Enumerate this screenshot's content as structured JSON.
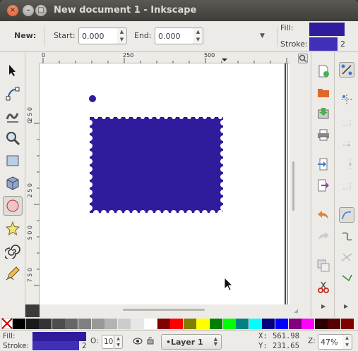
{
  "window": {
    "title": "New document 1 - Inkscape"
  },
  "controls": {
    "new_label": "New:",
    "start_label": "Start:",
    "start_value": "0.000",
    "end_label": "End:",
    "end_value": "0.000",
    "fill_label": "Fill:",
    "stroke_label": "Stroke:",
    "stroke_width": "2",
    "fill_color": "#2e1c9c"
  },
  "ruler": {
    "top_ticks": [
      "0",
      "250",
      "500"
    ],
    "left_ticks": [
      "2 5 0",
      "0",
      "2 5 0",
      "5 0 0",
      "7 5 0"
    ]
  },
  "tools": [
    "selector-tool",
    "node-tool",
    "tweak-tool",
    "zoom-tool",
    "rect-tool",
    "3dbox-tool",
    "ellipse-tool",
    "star-tool",
    "spiral-tool",
    "pencil-tool"
  ],
  "palette": [
    "#000000",
    "#1a1a1a",
    "#333333",
    "#4d4d4d",
    "#666666",
    "#808080",
    "#999999",
    "#b3b3b3",
    "#cccccc",
    "#e6e6e6",
    "#ffffff",
    "#800000",
    "#ff0000",
    "#808000",
    "#ffff00",
    "#008000",
    "#00ff00",
    "#008080",
    "#00ffff",
    "#000080",
    "#0000ff",
    "#800080",
    "#ff00ff",
    "#2b0000",
    "#550000",
    "#800000"
  ],
  "status": {
    "fill_label": "Fill:",
    "stroke_label": "Stroke:",
    "stroke_width": "2",
    "opacity_label": "O:",
    "opacity_value": "10",
    "layer": "•Layer 1",
    "x_label": "X:",
    "x_value": "561.98",
    "y_label": "Y:",
    "y_value": "231.65",
    "z_label": "Z:",
    "zoom_value": "47%"
  }
}
